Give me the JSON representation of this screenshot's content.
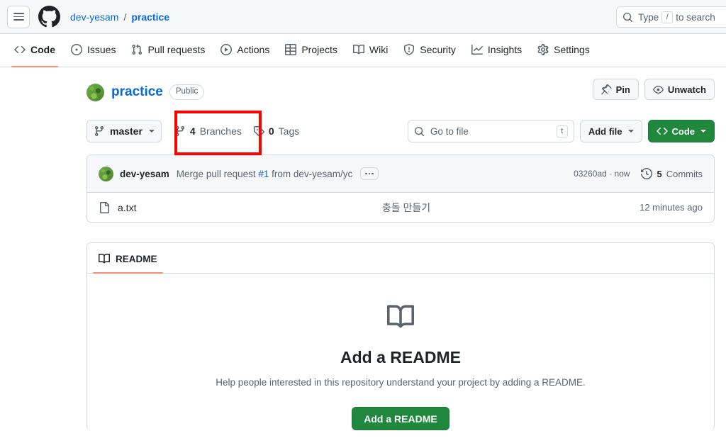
{
  "header": {
    "menu_icon": "hamburger-menu-icon",
    "logo_icon": "github-logo-icon",
    "owner": "dev-yesam",
    "separator": "/",
    "repo": "practice",
    "search": {
      "icon": "search-icon",
      "placeholder_pre": "Type",
      "kbd": "/",
      "placeholder_post": "to search"
    }
  },
  "repo_nav": {
    "items": [
      {
        "label": "Code",
        "icon": "code-icon",
        "active": true
      },
      {
        "label": "Issues",
        "icon": "issue-opened-icon",
        "active": false
      },
      {
        "label": "Pull requests",
        "icon": "git-pull-request-icon",
        "active": false
      },
      {
        "label": "Actions",
        "icon": "play-icon",
        "active": false
      },
      {
        "label": "Projects",
        "icon": "table-icon",
        "active": false
      },
      {
        "label": "Wiki",
        "icon": "book-icon",
        "active": false
      },
      {
        "label": "Security",
        "icon": "shield-icon",
        "active": false
      },
      {
        "label": "Insights",
        "icon": "graph-icon",
        "active": false
      },
      {
        "label": "Settings",
        "icon": "gear-icon",
        "active": false
      }
    ]
  },
  "repo_header": {
    "avatar_icon": "repo-owner-avatar",
    "name": "practice",
    "visibility": "Public",
    "pin_label": "Pin",
    "pin_icon": "pin-icon",
    "watch_label": "Unwatch",
    "watch_icon": "eye-icon"
  },
  "toolbar": {
    "branch_icon": "git-branch-icon",
    "branch_name": "master",
    "branches_count": "4",
    "branches_label": "Branches",
    "tags_icon": "tag-icon",
    "tags_count": "0",
    "tags_label": "Tags",
    "file_search_icon": "search-icon",
    "file_search_placeholder": "Go to file",
    "file_search_kbd": "t",
    "add_file_label": "Add file",
    "code_label": "Code",
    "code_icon": "code-icon"
  },
  "annotation": {
    "color": "#ff0000",
    "target": "branches-link"
  },
  "commit_bar": {
    "avatar_icon": "commit-author-avatar",
    "author": "dev-yesam",
    "message_pre": "Merge pull request",
    "message_pr": "#1",
    "message_post": "from dev-yesam/yc",
    "expand_icon": "kebab-horizontal-icon",
    "hash": "03260ad",
    "hash_time": "now",
    "hash_full": "03260ad · now",
    "history_icon": "history-icon",
    "commits_count": "5",
    "commits_label": "Commits"
  },
  "files": [
    {
      "icon": "file-icon",
      "name": "a.txt",
      "commit_message": "충돌 만들기",
      "time": "12 minutes ago"
    }
  ],
  "readme": {
    "tab_icon": "book-icon",
    "tab_label": "README",
    "empty_icon": "book-icon-large",
    "title": "Add a README",
    "description": "Help people interested in this repository understand your project by adding a README.",
    "cta_label": "Add a README"
  },
  "colors": {
    "accent_green": "#1f883d",
    "link_blue": "#0969da",
    "active_tab_underline": "#fd8c73",
    "annotation_red": "#ff0000",
    "muted_text": "#59636e",
    "border": "#d1d9e0",
    "canvas_subtle": "#f6f8fa"
  }
}
